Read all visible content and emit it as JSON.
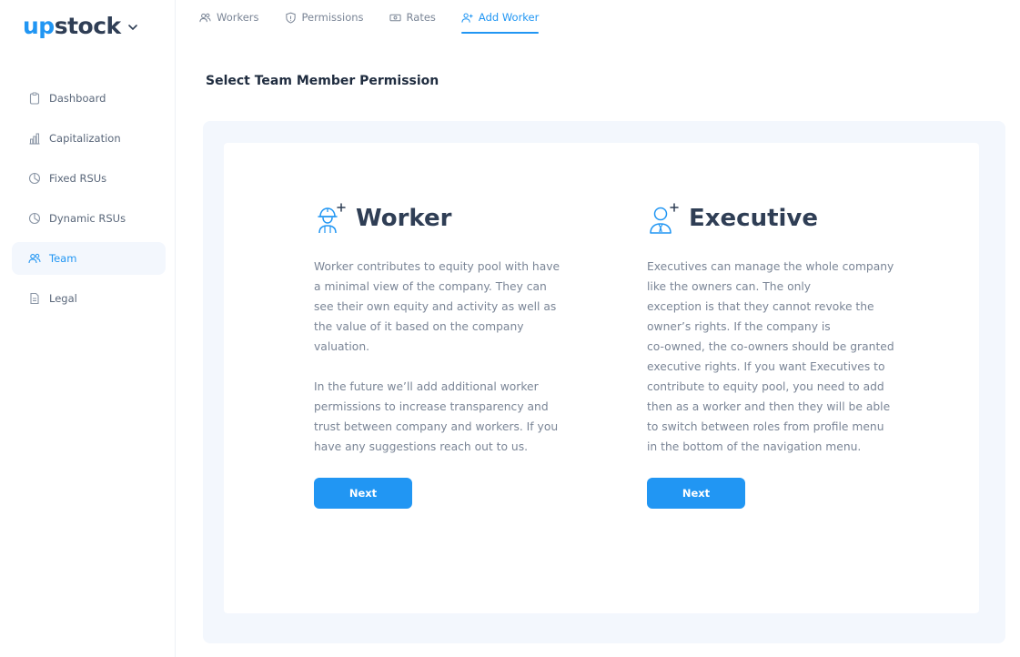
{
  "brand": {
    "logo_left": "up",
    "logo_mid": "st",
    "logo_o": "o",
    "logo_right": "ck"
  },
  "sidebar": {
    "items": [
      {
        "label": "Dashboard",
        "icon": "clipboard-icon"
      },
      {
        "label": "Capitalization",
        "icon": "bar-chart-icon"
      },
      {
        "label": "Fixed RSUs",
        "icon": "pie-chart-icon"
      },
      {
        "label": "Dynamic RSUs",
        "icon": "pie-chart-icon"
      },
      {
        "label": "Team",
        "icon": "users-icon",
        "active": true
      },
      {
        "label": "Legal",
        "icon": "document-icon"
      }
    ]
  },
  "tabs": [
    {
      "label": "Workers",
      "icon": "users-icon"
    },
    {
      "label": "Permissions",
      "icon": "shield-icon"
    },
    {
      "label": "Rates",
      "icon": "cash-icon"
    },
    {
      "label": "Add Worker",
      "icon": "user-plus-icon",
      "active": true
    }
  ],
  "page": {
    "title": "Select Team Member Permission"
  },
  "worker": {
    "title": "Worker",
    "description": "Worker contributes to equity pool with have a minimal view of the company. They can see their own equity and activity as well as the value of it based on the company valuation.\n\nIn the future we’ll add additional worker permissions to increase transparency and trust between company and workers. If you have any suggestions reach out to us.",
    "button": "Next"
  },
  "executive": {
    "title": "Executive",
    "description": "Executives can manage the whole company like the owners can. The only\nexception is that they cannot revoke the owner’s rights. If the company is\nco-owned, the co-owners should be granted executive rights. If you want  Executives to contribute to equity pool, you need to add then as a worker and then they will be able to switch between roles from profile menu in the bottom of the navigation menu.",
    "button": "Next"
  },
  "colors": {
    "accent": "#2196f3",
    "text_dark": "#2f3e55",
    "panel_bg": "#f3f7fd"
  }
}
